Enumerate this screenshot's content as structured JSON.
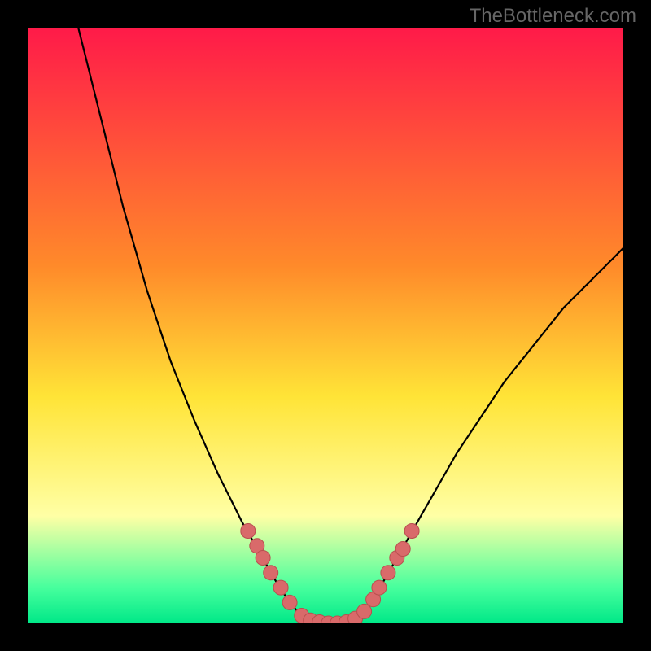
{
  "watermark": "TheBottleneck.com",
  "colors": {
    "bg": "#000000",
    "grad_top": "#ff1a49",
    "grad_mid1": "#ff8a2a",
    "grad_mid2": "#ffe437",
    "grad_low1": "#ffffa5",
    "grad_low2": "#47ff9d",
    "grad_bottom": "#00e888",
    "curve_stroke": "#000000",
    "marker_fill": "#d96a6a",
    "marker_stroke": "#b94f4f"
  },
  "chart_data": {
    "type": "line",
    "title": "",
    "xlabel": "",
    "ylabel": "",
    "xlim": [
      0,
      100
    ],
    "ylim": [
      0,
      100
    ],
    "curve": [
      {
        "x": 8.5,
        "y": 100
      },
      {
        "x": 10,
        "y": 94
      },
      {
        "x": 12,
        "y": 86
      },
      {
        "x": 14,
        "y": 78
      },
      {
        "x": 16,
        "y": 70
      },
      {
        "x": 18,
        "y": 63
      },
      {
        "x": 20,
        "y": 56
      },
      {
        "x": 22,
        "y": 50
      },
      {
        "x": 24,
        "y": 44
      },
      {
        "x": 26,
        "y": 39
      },
      {
        "x": 28,
        "y": 34
      },
      {
        "x": 30,
        "y": 29.5
      },
      {
        "x": 32,
        "y": 25
      },
      {
        "x": 34,
        "y": 21
      },
      {
        "x": 36,
        "y": 17
      },
      {
        "x": 38,
        "y": 13.5
      },
      {
        "x": 40,
        "y": 10
      },
      {
        "x": 42,
        "y": 6.5
      },
      {
        "x": 44,
        "y": 3.5
      },
      {
        "x": 46,
        "y": 1.2
      },
      {
        "x": 48,
        "y": 0.3
      },
      {
        "x": 50,
        "y": 0
      },
      {
        "x": 52,
        "y": 0
      },
      {
        "x": 54,
        "y": 0.3
      },
      {
        "x": 56,
        "y": 1.5
      },
      {
        "x": 58,
        "y": 4
      },
      {
        "x": 60,
        "y": 7.5
      },
      {
        "x": 62,
        "y": 11
      },
      {
        "x": 64,
        "y": 14.5
      },
      {
        "x": 66,
        "y": 18
      },
      {
        "x": 68,
        "y": 21.5
      },
      {
        "x": 70,
        "y": 25
      },
      {
        "x": 72,
        "y": 28.5
      },
      {
        "x": 74,
        "y": 31.5
      },
      {
        "x": 76,
        "y": 34.5
      },
      {
        "x": 78,
        "y": 37.5
      },
      {
        "x": 80,
        "y": 40.5
      },
      {
        "x": 82,
        "y": 43
      },
      {
        "x": 84,
        "y": 45.5
      },
      {
        "x": 86,
        "y": 48
      },
      {
        "x": 88,
        "y": 50.5
      },
      {
        "x": 90,
        "y": 53
      },
      {
        "x": 92,
        "y": 55
      },
      {
        "x": 94,
        "y": 57
      },
      {
        "x": 96,
        "y": 59
      },
      {
        "x": 98,
        "y": 61
      },
      {
        "x": 100,
        "y": 63
      }
    ],
    "markers": [
      {
        "x": 37.0,
        "y": 15.5
      },
      {
        "x": 38.5,
        "y": 13.0
      },
      {
        "x": 39.5,
        "y": 11.0
      },
      {
        "x": 40.8,
        "y": 8.5
      },
      {
        "x": 42.5,
        "y": 6.0
      },
      {
        "x": 44.0,
        "y": 3.5
      },
      {
        "x": 46.0,
        "y": 1.3
      },
      {
        "x": 47.5,
        "y": 0.5
      },
      {
        "x": 49.0,
        "y": 0.2
      },
      {
        "x": 50.5,
        "y": 0.0
      },
      {
        "x": 52.0,
        "y": 0.0
      },
      {
        "x": 53.5,
        "y": 0.2
      },
      {
        "x": 55.0,
        "y": 0.8
      },
      {
        "x": 56.5,
        "y": 2.0
      },
      {
        "x": 58.0,
        "y": 4.0
      },
      {
        "x": 59.0,
        "y": 6.0
      },
      {
        "x": 60.5,
        "y": 8.5
      },
      {
        "x": 62.0,
        "y": 11.0
      },
      {
        "x": 63.0,
        "y": 12.5
      },
      {
        "x": 64.5,
        "y": 15.5
      }
    ]
  }
}
